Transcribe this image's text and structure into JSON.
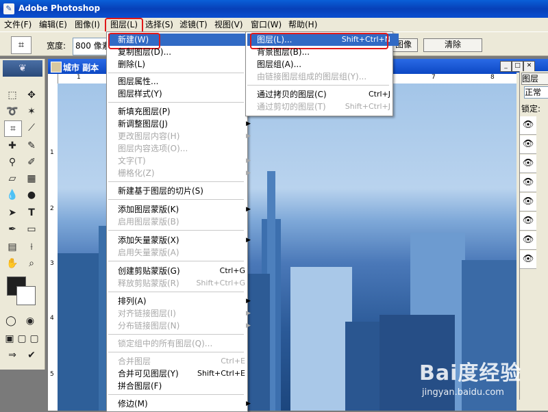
{
  "window": {
    "title": "Adobe Photoshop"
  },
  "menubar": {
    "items": [
      "文件(F)",
      "编辑(E)",
      "图像(I)",
      "图层(L)",
      "选择(S)",
      "滤镜(T)",
      "视图(V)",
      "窗口(W)",
      "帮助(H)"
    ]
  },
  "options_bar": {
    "width_label": "宽度:",
    "width_value": "800 像素",
    "image_button": "图像",
    "clear_button": "清除"
  },
  "document": {
    "title": "城市 副本",
    "ruler_top": [
      "1",
      "7",
      "8"
    ],
    "ruler_left": [
      "1",
      "2",
      "3",
      "4",
      "5"
    ]
  },
  "layers_panel": {
    "tab": "图层",
    "blend_mode": "正常",
    "lock_label": "锁定:"
  },
  "layer_menu": {
    "items": [
      {
        "label": "新建(W)",
        "shortcut": "",
        "submenu": true,
        "disabled": false
      },
      {
        "label": "复制图层(D)...",
        "shortcut": "",
        "submenu": false,
        "disabled": false
      },
      {
        "label": "删除(L)",
        "shortcut": "",
        "submenu": true,
        "disabled": false
      },
      {
        "label": "图层属性...",
        "shortcut": "",
        "submenu": false,
        "disabled": false
      },
      {
        "label": "图层样式(Y)",
        "shortcut": "",
        "submenu": true,
        "disabled": false
      },
      {
        "label": "新填充图层(P)",
        "shortcut": "",
        "submenu": true,
        "disabled": false
      },
      {
        "label": "新调整图层(J)",
        "shortcut": "",
        "submenu": true,
        "disabled": false
      },
      {
        "label": "更改图层内容(H)",
        "shortcut": "",
        "submenu": true,
        "disabled": true
      },
      {
        "label": "图层内容选项(O)...",
        "shortcut": "",
        "submenu": false,
        "disabled": true
      },
      {
        "label": "文字(T)",
        "shortcut": "",
        "submenu": true,
        "disabled": true
      },
      {
        "label": "栅格化(Z)",
        "shortcut": "",
        "submenu": true,
        "disabled": true
      },
      {
        "label": "新建基于图层的切片(S)",
        "shortcut": "",
        "submenu": false,
        "disabled": false
      },
      {
        "label": "添加图层蒙版(K)",
        "shortcut": "",
        "submenu": true,
        "disabled": false
      },
      {
        "label": "启用图层蒙版(B)",
        "shortcut": "",
        "submenu": false,
        "disabled": true
      },
      {
        "label": "添加矢量蒙版(X)",
        "shortcut": "",
        "submenu": true,
        "disabled": false
      },
      {
        "label": "启用矢量蒙版(A)",
        "shortcut": "",
        "submenu": false,
        "disabled": true
      },
      {
        "label": "创建剪贴蒙版(G)",
        "shortcut": "Ctrl+G",
        "submenu": false,
        "disabled": false
      },
      {
        "label": "释放剪贴蒙版(R)",
        "shortcut": "Shift+Ctrl+G",
        "submenu": false,
        "disabled": true
      },
      {
        "label": "排列(A)",
        "shortcut": "",
        "submenu": true,
        "disabled": false
      },
      {
        "label": "对齐链接图层(I)",
        "shortcut": "",
        "submenu": true,
        "disabled": true
      },
      {
        "label": "分布链接图层(N)",
        "shortcut": "",
        "submenu": true,
        "disabled": true
      },
      {
        "label": "锁定组中的所有图层(Q)...",
        "shortcut": "",
        "submenu": false,
        "disabled": true
      },
      {
        "label": "合并图层",
        "shortcut": "Ctrl+E",
        "submenu": false,
        "disabled": true
      },
      {
        "label": "合并可见图层(Y)",
        "shortcut": "Shift+Ctrl+E",
        "submenu": false,
        "disabled": false
      },
      {
        "label": "拼合图层(F)",
        "shortcut": "",
        "submenu": false,
        "disabled": false
      },
      {
        "label": "修边(M)",
        "shortcut": "",
        "submenu": true,
        "disabled": false
      }
    ]
  },
  "new_submenu": {
    "items": [
      {
        "label": "图层(L)...",
        "shortcut": "Shift+Ctrl+N",
        "disabled": false
      },
      {
        "label": "背景图层(B)...",
        "shortcut": "",
        "disabled": false
      },
      {
        "label": "图层组(A)...",
        "shortcut": "",
        "disabled": false
      },
      {
        "label": "由链接图层组成的图层组(Y)...",
        "shortcut": "",
        "disabled": true
      },
      {
        "label": "通过拷贝的图层(C)",
        "shortcut": "Ctrl+J",
        "disabled": false
      },
      {
        "label": "通过剪切的图层(T)",
        "shortcut": "Shift+Ctrl+J",
        "disabled": true
      }
    ]
  },
  "watermark": {
    "logo": "Bai度经验",
    "url": "jingyan.baidu.com"
  },
  "colors": {
    "accent": "#316ac5",
    "highlight_box": "#e01818",
    "titlebar": "#0a5fd8"
  }
}
